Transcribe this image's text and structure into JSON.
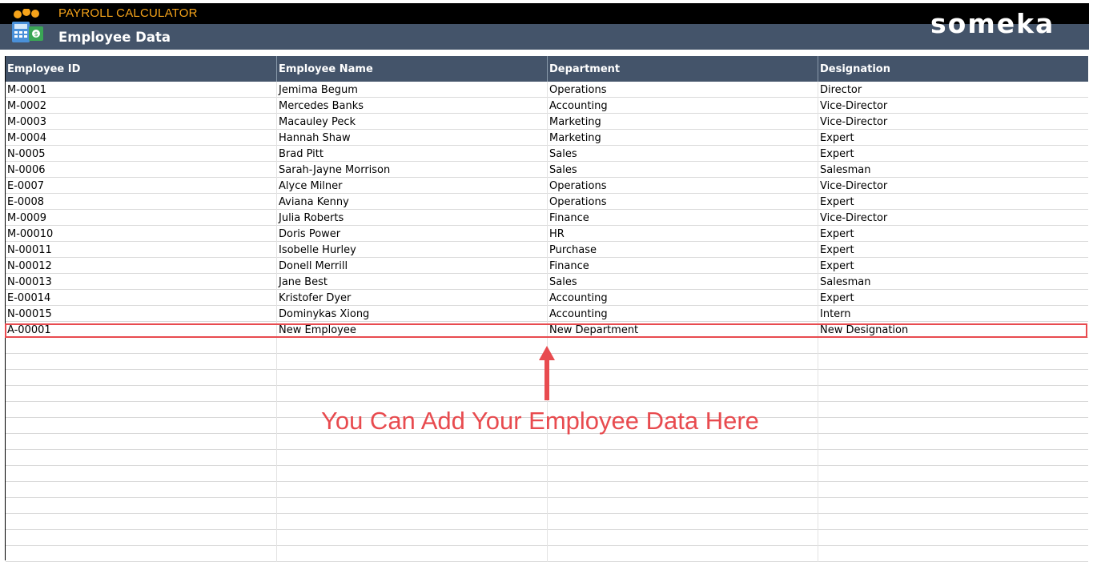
{
  "header": {
    "app_title": "PAYROLL CALCULATOR",
    "page_title": "Employee Data",
    "brand": "someka",
    "logo_icon": "payroll-calculator-icon"
  },
  "table": {
    "columns": [
      "Employee ID",
      "Employee Name",
      "Department",
      "Designation"
    ],
    "rows": [
      [
        "M-0001",
        "Jemima Begum",
        "Operations",
        "Director"
      ],
      [
        "M-0002",
        "Mercedes Banks",
        "Accounting",
        "Vice-Director"
      ],
      [
        "M-0003",
        "Macauley Peck",
        "Marketing",
        "Vice-Director"
      ],
      [
        "M-0004",
        "Hannah Shaw",
        "Marketing",
        "Expert"
      ],
      [
        "N-0005",
        "Brad Pitt",
        "Sales",
        "Expert"
      ],
      [
        "N-0006",
        "Sarah-Jayne Morrison",
        "Sales",
        "Salesman"
      ],
      [
        "E-0007",
        "Alyce Milner",
        "Operations",
        "Vice-Director"
      ],
      [
        "E-0008",
        "Aviana Kenny",
        "Operations",
        "Expert"
      ],
      [
        "M-0009",
        "Julia Roberts",
        "Finance",
        "Vice-Director"
      ],
      [
        "M-00010",
        "Doris Power",
        "HR",
        "Expert"
      ],
      [
        "N-00011",
        "Isobelle Hurley",
        "Purchase",
        "Expert"
      ],
      [
        "N-00012",
        "Donell Merrill",
        "Finance",
        "Expert"
      ],
      [
        "N-00013",
        "Jane Best",
        "Sales",
        "Salesman"
      ],
      [
        "E-00014",
        "Kristofer Dyer",
        "Accounting",
        "Expert"
      ],
      [
        "N-00015",
        "Dominykas Xiong",
        "Accounting",
        "Intern"
      ],
      [
        "A-00001",
        "New Employee",
        "New Department",
        "New Designation"
      ]
    ],
    "empty_rows": 14
  },
  "annotation": {
    "callout": "You Can Add Your Employee Data Here",
    "color": "#e84b4f"
  },
  "colors": {
    "header_dark": "#000000",
    "header_bar": "#44546a",
    "accent_orange": "#f5a31a"
  }
}
